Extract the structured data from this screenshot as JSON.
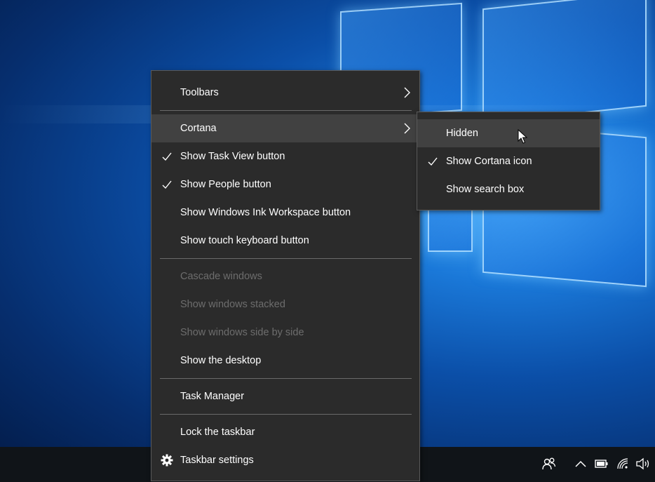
{
  "menu": {
    "items": [
      {
        "label": "Toolbars",
        "checked": false,
        "disabled": false,
        "submenu": true
      },
      {
        "label": "Cortana",
        "checked": false,
        "disabled": false,
        "submenu": true,
        "highlighted": true
      },
      {
        "label": "Show Task View button",
        "checked": true,
        "disabled": false
      },
      {
        "label": "Show People button",
        "checked": true,
        "disabled": false
      },
      {
        "label": "Show Windows Ink Workspace button",
        "checked": false,
        "disabled": false
      },
      {
        "label": "Show touch keyboard button",
        "checked": false,
        "disabled": false
      },
      {
        "label": "Cascade windows",
        "checked": false,
        "disabled": true
      },
      {
        "label": "Show windows stacked",
        "checked": false,
        "disabled": true
      },
      {
        "label": "Show windows side by side",
        "checked": false,
        "disabled": true
      },
      {
        "label": "Show the desktop",
        "checked": false,
        "disabled": false
      },
      {
        "label": "Task Manager",
        "checked": false,
        "disabled": false
      },
      {
        "label": "Lock the taskbar",
        "checked": false,
        "disabled": false
      },
      {
        "label": "Taskbar settings",
        "checked": false,
        "disabled": false,
        "icon": "gear-icon"
      }
    ]
  },
  "submenu": {
    "parent": "Cortana",
    "items": [
      {
        "label": "Hidden",
        "checked": false,
        "highlighted": true
      },
      {
        "label": "Show Cortana icon",
        "checked": true
      },
      {
        "label": "Show search box",
        "checked": false
      }
    ]
  },
  "tray": {
    "icons": [
      "people-icon",
      "chevron-up-icon",
      "battery-icon",
      "wifi-icon",
      "volume-icon"
    ]
  },
  "colors": {
    "menu_bg": "#2b2b2b",
    "menu_hover": "#414141",
    "text": "#ffffff",
    "disabled_text": "#6d6d6d",
    "separator": "#6a6a6a",
    "taskbar": "#101418"
  }
}
